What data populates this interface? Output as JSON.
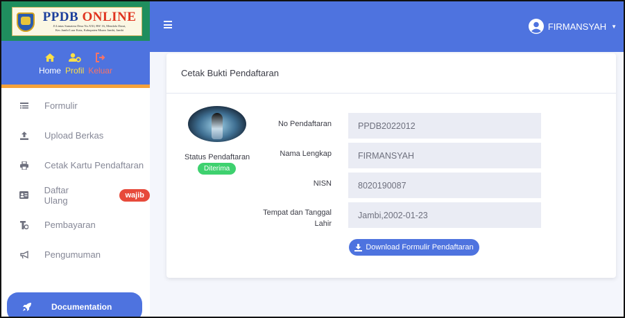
{
  "brand": {
    "title_part1": "PPDB ",
    "title_part2": "ONLINE",
    "subtitle_line1": "Jl.Lintas Sumatera Desa No.XXI, RW 16, Mendalo Darat,",
    "subtitle_line2": "Kec.Jambi Luar Kota, Kabupaten Muaro Jambi, Jambi"
  },
  "topnav": {
    "home": "Home",
    "profil": "Profil",
    "keluar": "Keluar"
  },
  "menu": [
    {
      "label": "Formulir",
      "icon": "form-list-icon"
    },
    {
      "label": "Upload Berkas",
      "icon": "upload-icon"
    },
    {
      "label": "Cetak Kartu Pendaftaran",
      "icon": "print-icon"
    },
    {
      "label": "Daftar Ulang",
      "icon": "id-card-icon",
      "badge": "wajib"
    },
    {
      "label": "Pembayaran",
      "icon": "payment-icon"
    },
    {
      "label": "Pengumuman",
      "icon": "megaphone-icon"
    }
  ],
  "documentation": "Documentation",
  "user": {
    "name": "FIRMANSYAH"
  },
  "card": {
    "title": "Cetak Bukti Pendaftaran",
    "status_label": "Status Pendaftaran",
    "status_value": "Diterima",
    "fields": [
      {
        "label": "No Pendaftaran",
        "value": "PPDB2022012"
      },
      {
        "label": "Nama Lengkap",
        "value": "FIRMANSYAH"
      },
      {
        "label": "NISN",
        "value": "8020190087"
      },
      {
        "label_line1": "Tempat dan Tanggal",
        "label_line2": "Lahir",
        "value": "Jambi,2002-01-23"
      }
    ],
    "download_label": "Download Formulir Pendaftaran"
  },
  "colors": {
    "primary": "#4e73df",
    "brand_green": "#1f8e5e",
    "accent_orange": "#f6a23a",
    "danger": "#e74a3b",
    "success": "#3ed16f"
  }
}
